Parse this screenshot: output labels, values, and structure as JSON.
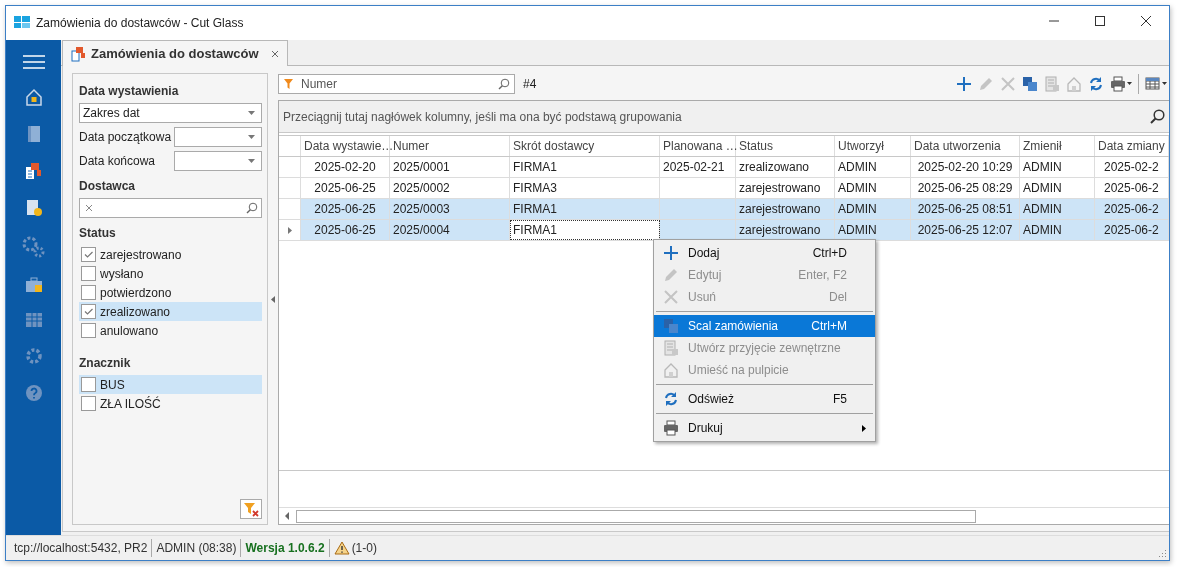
{
  "window": {
    "title": "Zamówienia do dostawców - Cut Glass"
  },
  "tabs": [
    {
      "label": "Zamówienia do dostawców",
      "selected": true
    }
  ],
  "filters": {
    "date_heading": "Data wystawienia",
    "date_mode": "Zakres dat",
    "date_from_label": "Data początkowa",
    "date_to_label": "Data końcowa",
    "supplier_heading": "Dostawca",
    "status_heading": "Status",
    "statuses": [
      {
        "label": "zarejestrowano",
        "checked": true,
        "highlighted": false
      },
      {
        "label": "wysłano",
        "checked": false,
        "highlighted": false
      },
      {
        "label": "potwierdzono",
        "checked": false,
        "highlighted": false
      },
      {
        "label": "zrealizowano",
        "checked": true,
        "highlighted": true
      },
      {
        "label": "anulowano",
        "checked": false,
        "highlighted": false
      }
    ],
    "tag_heading": "Znacznik",
    "tags": [
      {
        "label": "BUS",
        "checked": false,
        "highlighted": true
      },
      {
        "label": "ZŁA ILOŚĆ",
        "checked": false,
        "highlighted": false
      }
    ]
  },
  "grid": {
    "search_placeholder": "Numer",
    "record_count": "#4",
    "toolbar": [
      {
        "disabled": false
      },
      {
        "disabled": true
      },
      {
        "disabled": true
      },
      {
        "disabled": false
      },
      {
        "disabled": true
      },
      {
        "disabled": true
      },
      {
        "disabled": false
      },
      {
        "disabled": false
      },
      {
        "disabled": false
      }
    ],
    "group_panel_hint": "Przeciągnij tutaj nagłówek kolumny, jeśli ma ona być podstawą grupowania",
    "columns": [
      {
        "label": "Data wystawie…",
        "focused": false
      },
      {
        "label": "Numer",
        "focused": false
      },
      {
        "label": "Skrót dostawcy",
        "focused": true
      },
      {
        "label": "Planowana …",
        "focused": false
      },
      {
        "label": "Status",
        "focused": false
      },
      {
        "label": "Utworzył",
        "focused": false
      },
      {
        "label": "Data utworzenia",
        "focused": false
      },
      {
        "label": "Zmienił",
        "focused": false
      },
      {
        "label": "Data zmiany",
        "focused": false
      }
    ],
    "rows": [
      {
        "cells": [
          "2025-02-20",
          "2025/0001",
          "FIRMA1",
          "2025-02-21",
          "zrealizowano",
          "ADMIN",
          "2025-02-20 10:29",
          "ADMIN",
          "2025-02-2"
        ],
        "selected": false,
        "current": false
      },
      {
        "cells": [
          "2025-06-25",
          "2025/0002",
          "FIRMA3",
          "",
          "zarejestrowano",
          "ADMIN",
          "2025-06-25 08:29",
          "ADMIN",
          "2025-06-2"
        ],
        "selected": false,
        "current": false
      },
      {
        "cells": [
          "2025-06-25",
          "2025/0003",
          "FIRMA1",
          "",
          "zarejestrowano",
          "ADMIN",
          "2025-06-25 08:51",
          "ADMIN",
          "2025-06-2"
        ],
        "selected": true,
        "current": false
      },
      {
        "cells": [
          "2025-06-25",
          "2025/0004",
          "FIRMA1",
          "",
          "zarejestrowano",
          "ADMIN",
          "2025-06-25 12:07",
          "ADMIN",
          "2025-06-2"
        ],
        "selected": true,
        "current": true
      }
    ]
  },
  "context_menu": [
    {
      "kind": "item",
      "label": "Dodaj",
      "shortcut": "Ctrl+D",
      "disabled": false,
      "highlighted": false,
      "submenu": false
    },
    {
      "kind": "item",
      "label": "Edytuj",
      "shortcut": "Enter, F2",
      "disabled": true,
      "highlighted": false,
      "submenu": false
    },
    {
      "kind": "item",
      "label": "Usuń",
      "shortcut": "Del",
      "disabled": true,
      "highlighted": false,
      "submenu": false
    },
    {
      "kind": "separator"
    },
    {
      "kind": "item",
      "label": "Scal zamówienia",
      "shortcut": "Ctrl+M",
      "disabled": false,
      "highlighted": true,
      "submenu": false
    },
    {
      "kind": "item",
      "label": "Utwórz przyjęcie zewnętrzne",
      "disabled": true,
      "highlighted": false,
      "submenu": false
    },
    {
      "kind": "item",
      "label": "Umieść na pulpicie",
      "disabled": true,
      "highlighted": false,
      "submenu": false
    },
    {
      "kind": "separator"
    },
    {
      "kind": "item",
      "label": "Odśwież",
      "shortcut": "F5",
      "disabled": false,
      "highlighted": false,
      "submenu": false
    },
    {
      "kind": "separator"
    },
    {
      "kind": "item",
      "label": "Drukuj",
      "disabled": false,
      "highlighted": false,
      "submenu": true
    }
  ],
  "status_bar": {
    "connection": "tcp://localhost:5432, PR2",
    "user": "ADMIN (08:38)",
    "version": "Wersja 1.0.6.2",
    "warnings": "(1-0)"
  }
}
